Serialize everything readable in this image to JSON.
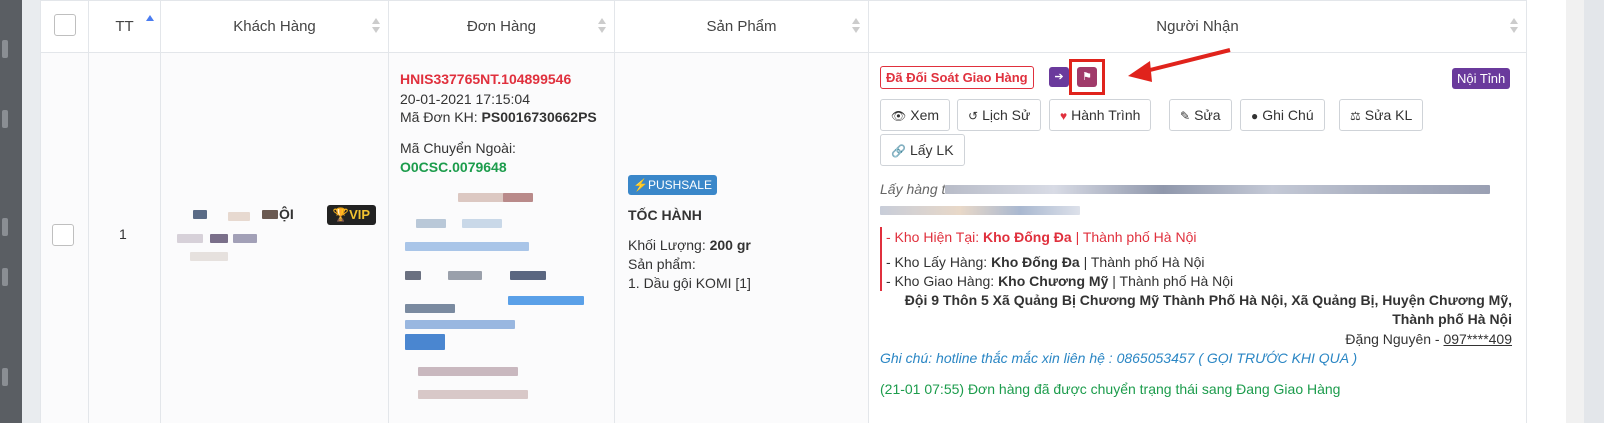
{
  "table": {
    "columns": [
      {
        "label": ""
      },
      {
        "label": "TT"
      },
      {
        "label": "Khách Hàng"
      },
      {
        "label": "Đơn Hàng"
      },
      {
        "label": "Sản Phẩm"
      },
      {
        "label": "Người Nhận"
      }
    ]
  },
  "row": {
    "index": "1",
    "customer": {
      "name_suffix": "ỘI",
      "vip_label": "VIP"
    },
    "order": {
      "code": "HNIS337765NT.104899546",
      "datetime": "20-01-2021 17:15:04",
      "customer_code_label": "Mã Đơn KH:",
      "customer_code": "PS0016730662PS",
      "external_code_label": "Mã Chuyển Ngoài:",
      "external_code": "O0CSC.0079648"
    },
    "product": {
      "badge": "PUSHSALE",
      "service": "TỐC HÀNH",
      "weight_label": "Khối Lượng:",
      "weight": "200 gr",
      "products_label": "Sản phẩm:",
      "product_line": "1. Dầu gội KOMI [1]"
    },
    "recipient": {
      "status_badge": "Đã Đối Soát Giao Hàng",
      "region_badge": "Nội Tỉnh",
      "buttons": [
        {
          "label": "Xem",
          "icon": "eye-icon"
        },
        {
          "label": "Lịch Sử",
          "icon": "history-icon"
        },
        {
          "label": "Hành Trình",
          "icon": "heart-icon"
        },
        {
          "label": "Sửa",
          "icon": "pencil-icon"
        },
        {
          "label": "Ghi Chú",
          "icon": "comment-icon"
        },
        {
          "label": "Sửa KL",
          "icon": "scale-icon"
        },
        {
          "label": "Lấy LK",
          "icon": "link-icon"
        }
      ],
      "pickup_prefix": "Lấy hàng t",
      "current_warehouse_label": "- Kho Hiện Tại:",
      "current_warehouse": "Kho Đống Đa",
      "current_city": "| Thành phố Hà Nội",
      "pickup_warehouse_label": "- Kho Lấy Hàng:",
      "pickup_warehouse": "Kho Đống Đa",
      "pickup_city": "| Thành phố Hà Nội",
      "delivery_warehouse_label": "- Kho Giao Hàng:",
      "delivery_warehouse": "Kho Chương Mỹ",
      "delivery_city": "| Thành phố Hà Nội",
      "address_line1": "Đội 9 Thôn 5 Xã Quảng Bị Chương Mỹ Thành Phố Hà Nội, Xã Quảng Bị, Huyện Chương Mỹ,",
      "address_line2": "Thành phố Hà Nội",
      "receiver_name": "Đặng Nguyên - ",
      "receiver_phone": "097****409",
      "note": "Ghi chú: hotline thắc mắc xin liên hệ : 0865053457 ( GỌI TRƯỚC KHI QUA )",
      "log": "(21-01 07:55) Đơn hàng đã được chuyển trạng thái sang Đang Giao Hàng"
    }
  },
  "colors": {
    "accent_red": "#e0303d",
    "green": "#1c9c4c",
    "purple": "#6a3a9c",
    "annotation_red": "#e0231c"
  }
}
